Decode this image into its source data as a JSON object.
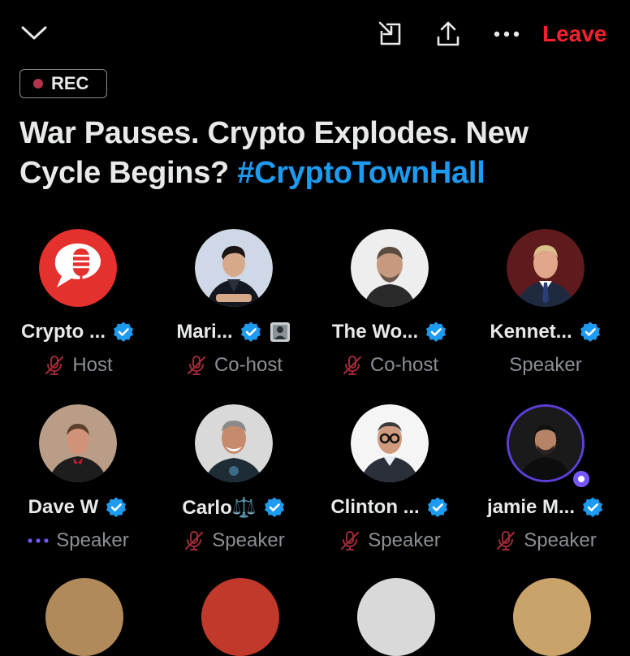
{
  "header": {
    "leave_label": "Leave",
    "rec_label": "REC"
  },
  "space": {
    "title_main": "War Pauses. Crypto Explodes. New Cycle Begins? ",
    "title_hashtag": "#CryptoTownHall"
  },
  "participants": [
    {
      "name": "Crypto ...",
      "role": "Host",
      "muted": true,
      "verified": true
    },
    {
      "name": "Mari...",
      "role": "Co-host",
      "muted": true,
      "verified": true,
      "extra_badge": true
    },
    {
      "name": "The Wo...",
      "role": "Co-host",
      "muted": true,
      "verified": true
    },
    {
      "name": "Kennet...",
      "role": "Speaker",
      "muted": false,
      "verified": true
    },
    {
      "name": "Dave W",
      "role": "Speaker",
      "muted": false,
      "speaking": true,
      "verified": true
    },
    {
      "name": "Carlo⚖️",
      "role": "Speaker",
      "muted": true,
      "verified": true
    },
    {
      "name": "Clinton ...",
      "role": "Speaker",
      "muted": true,
      "verified": true
    },
    {
      "name": "jamie M...",
      "role": "Speaker",
      "muted": true,
      "verified": true
    }
  ],
  "colors": {
    "accent": "#1d9bf0",
    "leave": "#f4212e",
    "muted_mic": "#9e2a36",
    "speaking": "#7856ff",
    "background": "#000000"
  },
  "icons": {
    "collapse": "chevron-down-icon",
    "minimize": "minimize-icon",
    "share": "share-icon",
    "more": "more-icon",
    "muted": "mic-off-icon",
    "verified": "verified-badge-icon"
  }
}
